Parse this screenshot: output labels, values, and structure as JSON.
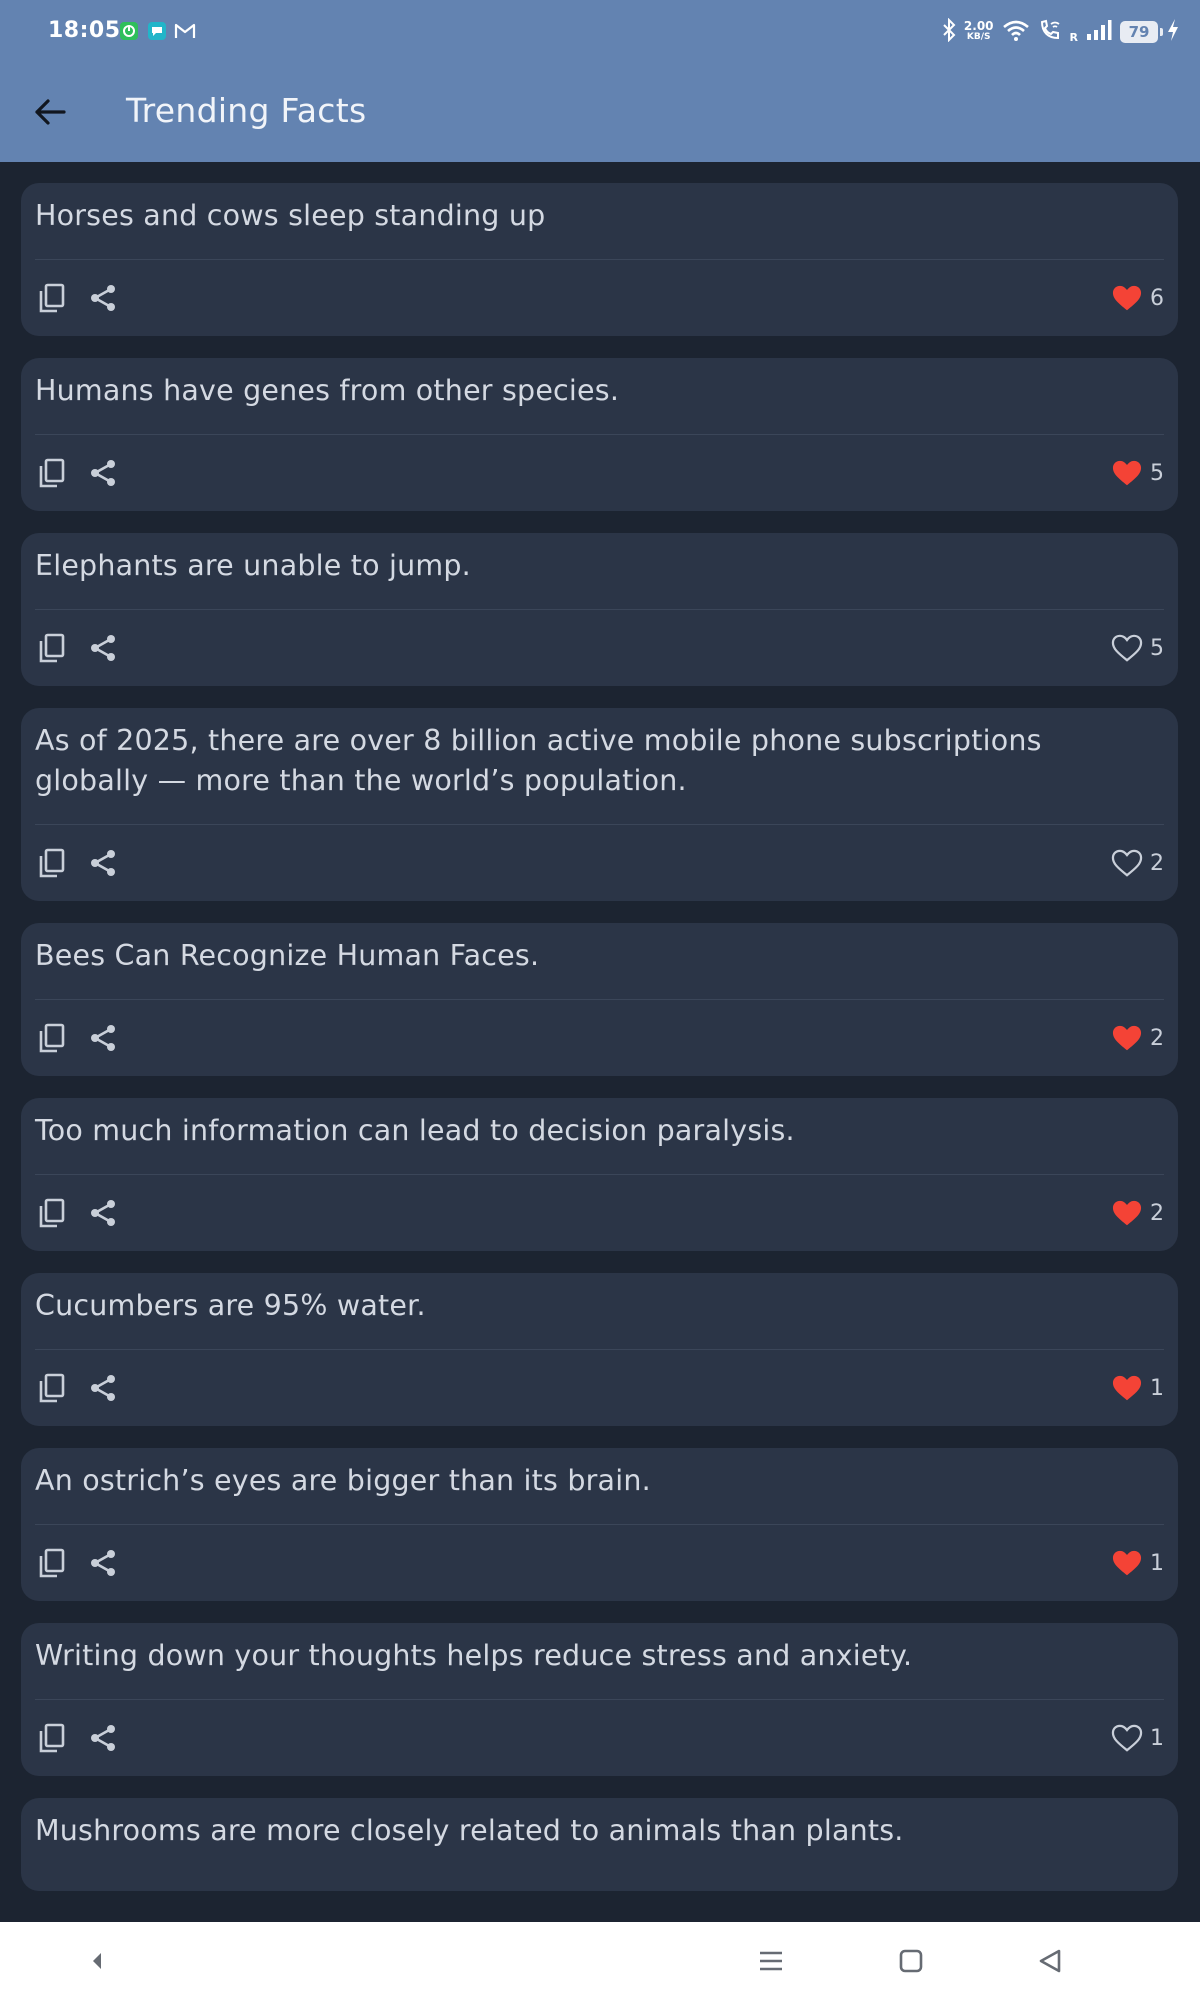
{
  "status_bar": {
    "time": "18:05",
    "network_speed": "2.00",
    "network_speed_unit": "KB/S",
    "roaming_indicator": "R",
    "battery_level": "79"
  },
  "app_bar": {
    "title": "Trending Facts",
    "back_icon": "arrow-left-icon"
  },
  "colors": {
    "header": "#6383b1",
    "background": "#1c2431",
    "card": "#2b3547",
    "like_active": "#f44336"
  },
  "facts": [
    {
      "text": "Horses and cows sleep standing up",
      "likes": "6",
      "liked": true
    },
    {
      "text": "Humans have genes from other species.",
      "likes": "5",
      "liked": true
    },
    {
      "text": "Elephants are unable to jump.",
      "likes": "5",
      "liked": false
    },
    {
      "text": "As of 2025, there are over 8 billion active mobile phone subscriptions globally — more than the world’s population.",
      "likes": "2",
      "liked": false
    },
    {
      "text": "Bees Can Recognize Human Faces.",
      "likes": "2",
      "liked": true
    },
    {
      "text": "Too much information can lead to decision paralysis.",
      "likes": "2",
      "liked": true
    },
    {
      "text": "Cucumbers are 95% water.",
      "likes": "1",
      "liked": true
    },
    {
      "text": "An ostrich’s eyes are bigger than its brain.",
      "likes": "1",
      "liked": true
    },
    {
      "text": "Writing down your thoughts helps reduce stress and anxiety.",
      "likes": "1",
      "liked": false
    },
    {
      "text": "Mushrooms are more closely related to animals than plants."
    }
  ],
  "nav_bar": {
    "items": [
      "collapse-icon",
      "recent-apps-icon",
      "home-icon",
      "back-icon"
    ]
  }
}
